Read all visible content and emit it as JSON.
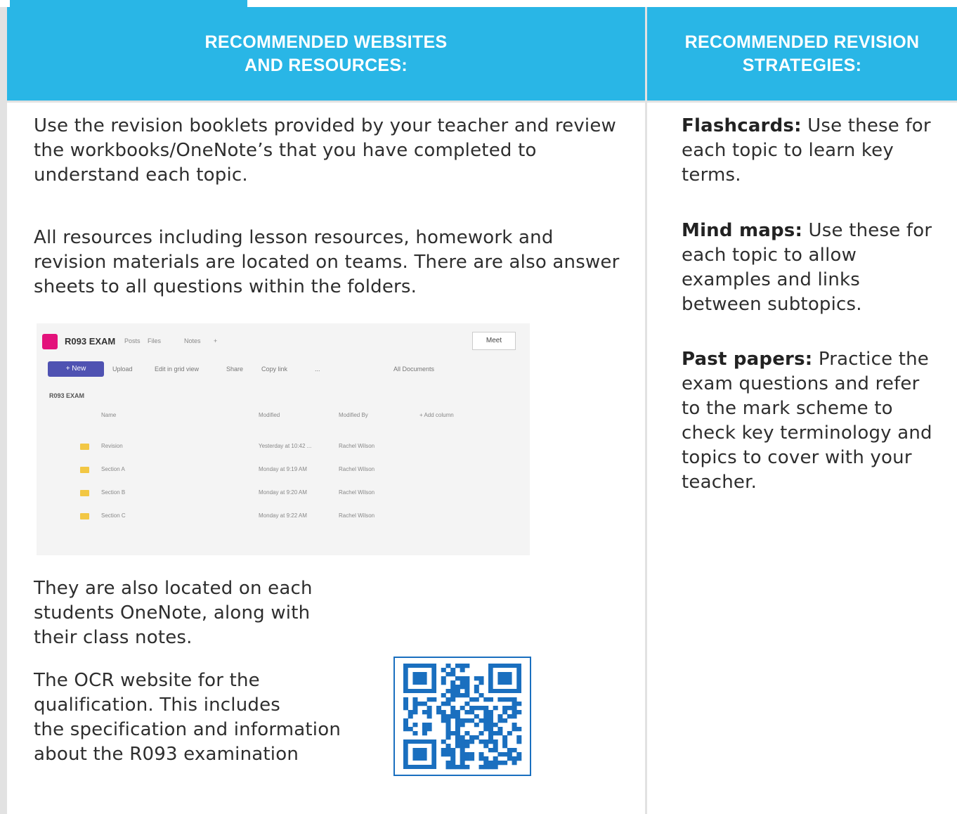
{
  "header": {
    "left_line1": "RECOMMENDED WEBSITES",
    "left_line2": "AND RESOURCES:",
    "right_line1": "RECOMMENDED REVISION",
    "right_line2": "STRATEGIES:"
  },
  "left": {
    "p1": "Use the revision booklets provided by your teacher and review the workbooks/OneNote’s that you have completed to understand each topic.",
    "p2": "All resources including lesson resources, homework and revision materials are located on teams. There are also answer sheets to all questions within the folders.",
    "p3": "They are also located on each students OneNote, along with their class notes.",
    "p4": "The OCR website for the qualification. This includes\n the specification and information about the R093 examination"
  },
  "right": {
    "s1_title": "Flashcards:",
    "s1_text": " Use these for each topic to learn key terms.",
    "s2_title": "Mind maps:",
    "s2_text": " Use these for each topic to allow examples and links between subtopics.",
    "s3_title": "Past papers:",
    "s3_text": " Practice the exam questions and refer to the mark scheme to check key terminology and topics to cover with your teacher."
  },
  "screenshot": {
    "team_name": "R093 EXAM",
    "tabs": [
      "Posts",
      "Files",
      "Notes",
      "+"
    ],
    "meet": "Meet",
    "new_button": "+ New",
    "toolbar": [
      "Upload",
      "Edit in grid view",
      "Share",
      "Copy link",
      "...",
      "All Documents"
    ],
    "crumb": "R093 EXAM",
    "columns": [
      "Name",
      "Modified",
      "Modified By",
      "+ Add column"
    ],
    "rows": [
      {
        "name": "Revision",
        "modified": "Yesterday at 10:42 ...",
        "by": "Rachel Wilson"
      },
      {
        "name": "Section A",
        "modified": "Monday at 9:19 AM",
        "by": "Rachel Wilson"
      },
      {
        "name": "Section B",
        "modified": "Monday at 9:20 AM",
        "by": "Rachel Wilson"
      },
      {
        "name": "Section C",
        "modified": "Monday at 9:22 AM",
        "by": "Rachel Wilson"
      }
    ]
  },
  "colors": {
    "header_blue": "#29b6e6",
    "qr_border": "#1a6fbf",
    "qr_module": "#1a6fbf"
  },
  "icons": [
    "folder-icon",
    "qr-code-icon",
    "team-logo-icon"
  ]
}
